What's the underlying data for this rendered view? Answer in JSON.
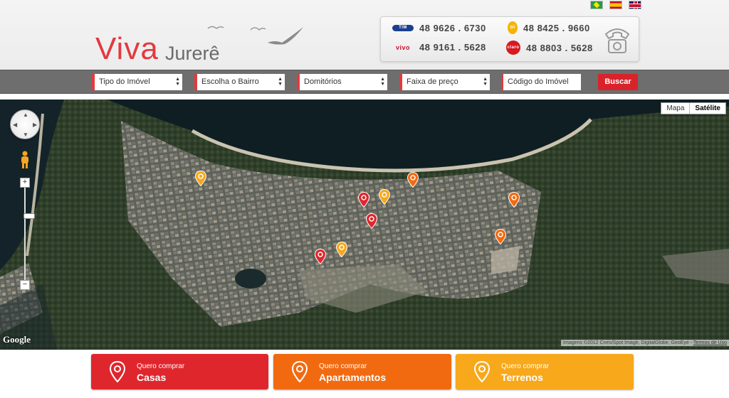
{
  "brand": {
    "name_part1": "Viva",
    "name_part2": "Jurerê"
  },
  "languages": [
    "Português",
    "Español",
    "English"
  ],
  "phones": [
    {
      "carrier": "TIM",
      "number": "48 9626 . 6730"
    },
    {
      "carrier": "vivo",
      "number": "48 9161 . 5628"
    },
    {
      "carrier": "oi",
      "number": "48 8425 . 9660"
    },
    {
      "carrier": "claro",
      "number": "48 8803 . 5628"
    }
  ],
  "search": {
    "tipo": "Tipo do Imóvel",
    "bairro": "Escolha o Bairro",
    "dormitorios": "Domitórios",
    "preco": "Faixa de preço",
    "codigo_placeholder": "Código do Imóvel",
    "button": "Buscar"
  },
  "map": {
    "type_map": "Mapa",
    "type_satellite": "Satélite",
    "active_type": "Satélite",
    "logo": "Google",
    "attribution": "Imagens ©2012 Cnes/Spot Image, DigitalGlobe, GeoEye -",
    "terms": "Termos de Uso",
    "pins": [
      {
        "category": "terrenos"
      },
      {
        "category": "apartamentos"
      },
      {
        "category": "casas"
      },
      {
        "category": "terrenos"
      },
      {
        "category": "apartamentos"
      },
      {
        "category": "casas"
      },
      {
        "category": "apartamentos"
      },
      {
        "category": "terrenos"
      },
      {
        "category": "casas"
      }
    ]
  },
  "colors": {
    "casas": "#e0262d",
    "apartamentos": "#f26a10",
    "terrenos": "#f7a81b",
    "accent": "#e23a3f"
  },
  "cta": [
    {
      "small": "Quero comprar",
      "big": "Casas"
    },
    {
      "small": "Quero comprar",
      "big": "Apartamentos"
    },
    {
      "small": "Quero comprar",
      "big": "Terrenos"
    }
  ]
}
